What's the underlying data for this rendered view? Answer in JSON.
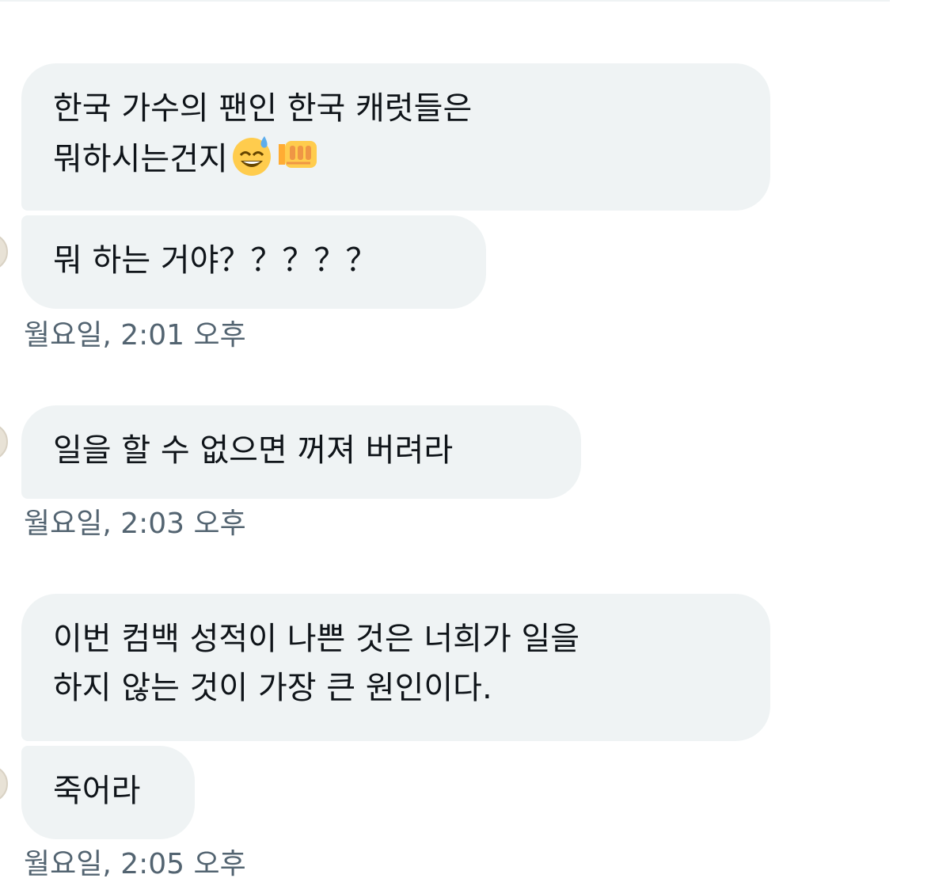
{
  "conversation": {
    "groups": [
      {
        "messages": [
          {
            "lines": [
              "한국 가수의 팬인 한국 캐럿들은",
              "뭐하시는건지"
            ]
          },
          {
            "lines": [
              "뭐 하는 거야？？？？？"
            ]
          }
        ],
        "timestamp": "월요일, 2:01 오후"
      },
      {
        "messages": [
          {
            "lines": [
              "일을 할 수 없으면 꺼져 버려라"
            ]
          }
        ],
        "timestamp": "월요일, 2:03 오후"
      },
      {
        "messages": [
          {
            "lines": [
              "이번 컴백 성적이 나쁜 것은 너희가 일을",
              "하지 않는 것이 가장 큰 원인이다."
            ]
          },
          {
            "lines": [
              "죽어라"
            ]
          }
        ],
        "timestamp": "월요일, 2:05 오후"
      }
    ],
    "emoji": {
      "first": "grinning-sweat-emoji",
      "second": "oncoming-fist-emoji"
    },
    "colors": {
      "bubble_bg": "#eff3f4",
      "text": "#0f1419",
      "timestamp": "#536471"
    }
  }
}
